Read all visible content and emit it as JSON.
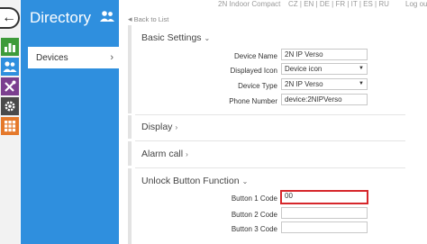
{
  "header": {
    "device_title": "2N Indoor Compact",
    "languages": "CZ | EN | DE | FR | IT | ES | RU",
    "logout": "Log ou"
  },
  "sidebar": {
    "title": "Directory",
    "items": [
      {
        "label": "Devices"
      }
    ]
  },
  "rail": {
    "icons": [
      "back-arrow-icon",
      "status-chart-icon",
      "directory-icon",
      "services-tools-icon",
      "hardware-gear-icon",
      "system-grid-icon"
    ]
  },
  "back_link": "Back to List",
  "sections": {
    "basic": {
      "title": "Basic Settings",
      "fields": {
        "device_name": {
          "label": "Device Name",
          "value": "2N IP Verso"
        },
        "displayed_icon": {
          "label": "Displayed Icon",
          "value": "Device icon"
        },
        "device_type": {
          "label": "Device Type",
          "value": "2N IP Verso"
        },
        "phone_number": {
          "label": "Phone Number",
          "value": "device:2NIPVerso"
        }
      }
    },
    "display": {
      "title": "Display"
    },
    "alarm_call": {
      "title": "Alarm call"
    },
    "unlock": {
      "title": "Unlock Button Function",
      "fields": {
        "button1": {
          "label": "Button 1 Code",
          "value": "00"
        },
        "button2": {
          "label": "Button 2 Code",
          "value": ""
        },
        "button3": {
          "label": "Button 3 Code",
          "value": ""
        }
      }
    }
  },
  "colors": {
    "panel_blue": "#2f8fde",
    "status_green": "#3e9b3a",
    "directory_blue": "#2f8fde",
    "services_purple": "#7b3f8f",
    "hardware_gray": "#4a4a4a",
    "system_orange": "#e5792b",
    "highlight_red": "#d6272b"
  }
}
